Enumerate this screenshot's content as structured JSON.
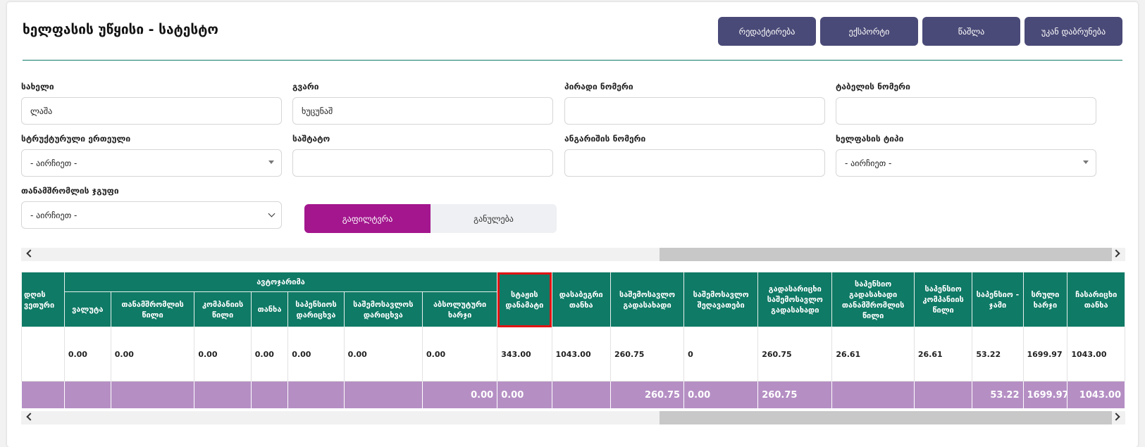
{
  "page": {
    "title": "ხელფასის უწყისი - სატესტო"
  },
  "actions": [
    "რედაქტირება",
    "ექსპორტი",
    "წაშლა",
    "უკან დაბრუნება"
  ],
  "form": {
    "first_name_label": "სახელი",
    "first_name_value": "ლაშა",
    "last_name_label": "გვარი",
    "last_name_value": "ხუცუნაშ",
    "personal_no_label": "პირადი ნომერი",
    "personal_no_value": "",
    "tabel_no_label": "ტაბელის ნომერი",
    "tabel_no_value": "",
    "unit_label": "სტრუქტურული ერთეული",
    "unit_value": "- აირჩიეთ -",
    "position_label": "საშტატო",
    "position_value": "",
    "account_label": "ანგარიშის ნომერი",
    "account_value": "",
    "salary_type_label": "ხელფასის ტიპი",
    "salary_type_value": "- აირჩიეთ -",
    "group_label": "თანამშრომლის ჯგუფი",
    "group_value": "- აირჩიეთ -"
  },
  "filter": {
    "apply_label": "გაფილტვრა",
    "reset_label": "განულება"
  },
  "table": {
    "group_header": "ავტოჯარიმა",
    "headers": {
      "day": "დღის ვეთური",
      "currency": "ვალუტა",
      "employee_share": "თანამშრომლის წილი",
      "company_share": "კომპანიის წილი",
      "amount": "თანხა",
      "pension_calc": "საპენსიოს დარიცხვა",
      "income_calc": "საშემოსავლოს დარიცხვა",
      "absolute_expense": "აბსოლუტური ხარჯი",
      "experience_bonus": "სტაჟის დანამატი",
      "taxable_amount": "დასაბეგრი თანხა",
      "income_tax": "საშემოსავლო გადასახადი",
      "income_relief": "საშემოსავლო შეღავათები",
      "payable_income_tax": "გადასარიცხი საშემოსავლო გადასახადი",
      "pension_employee": "საპენსიო გადასახადი თანამშრომლის წილი",
      "pension_company": "საპენსიო კომპანიის წილი",
      "pension_total": "საპენსიო - ჯამი",
      "full_expense": "სრული ხარჯი",
      "payable_amount": "ჩასარიცხი თანხა"
    },
    "row": {
      "day": "",
      "currency": "0.00",
      "employee_share": "0.00",
      "company_share": "0.00",
      "amount": "0.00",
      "pension_calc": "0.00",
      "income_calc": "0.00",
      "absolute_expense": "0.00",
      "experience_bonus": "343.00",
      "taxable_amount": "1043.00",
      "income_tax": "260.75",
      "income_relief": "0",
      "payable_income_tax": "260.75",
      "pension_employee": "26.61",
      "pension_company": "26.61",
      "pension_total": "53.22",
      "full_expense": "1699.97",
      "payable_amount": "1043.00"
    },
    "totals": {
      "absolute_expense": "0.00",
      "experience_bonus": "0.00",
      "income_tax": "260.75",
      "income_relief": "0.00",
      "payable_income_tax": "260.75",
      "pension_total": "53.22",
      "full_expense": "1699.97",
      "payable_amount": "1043.00"
    }
  }
}
